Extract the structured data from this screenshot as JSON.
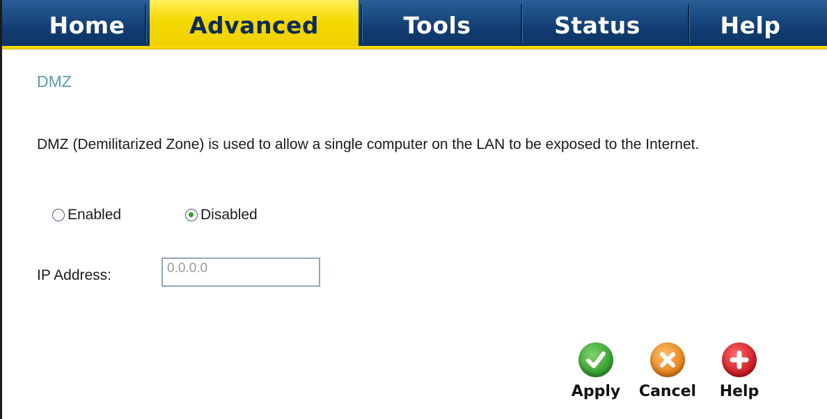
{
  "nav": {
    "tabs": [
      {
        "label": "Home"
      },
      {
        "label": "Advanced"
      },
      {
        "label": "Tools"
      },
      {
        "label": "Status"
      },
      {
        "label": "Help"
      }
    ],
    "active": "Advanced"
  },
  "page": {
    "title": "DMZ",
    "description": "DMZ (Demilitarized Zone) is used to allow a single computer on the LAN to be exposed to the Internet."
  },
  "dmz": {
    "enabled_label": "Enabled",
    "disabled_label": "Disabled",
    "selected": "Disabled",
    "ip_label": "IP Address:",
    "ip_value": "0.0.0.0"
  },
  "actions": {
    "apply_label": "Apply",
    "cancel_label": "Cancel",
    "help_label": "Help"
  },
  "colors": {
    "nav_blue": "#123e73",
    "nav_active_yellow": "#f4d800",
    "title_teal": "#5e9aa8",
    "apply_green": "#3aa638",
    "cancel_orange": "#e8891e",
    "help_red": "#d8202a"
  },
  "icons": {
    "apply": "checkmark-icon",
    "cancel": "x-icon",
    "help": "plus-icon"
  }
}
